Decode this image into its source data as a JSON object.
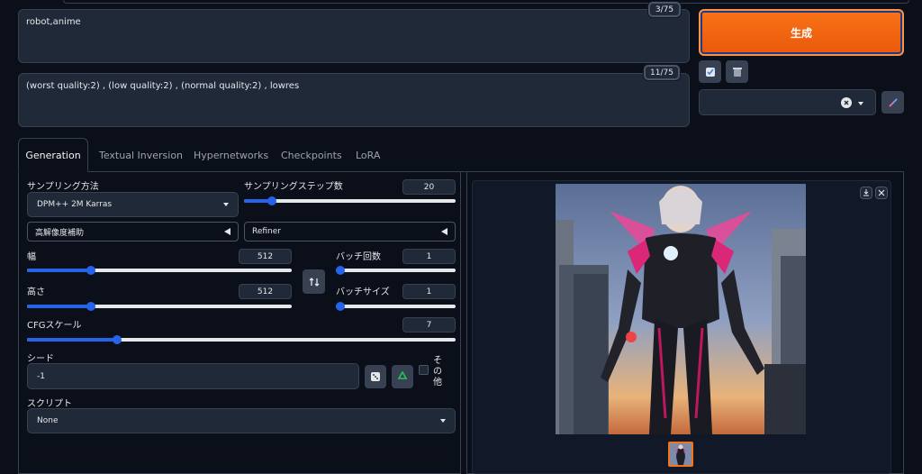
{
  "prompt": {
    "positive_text": "robot,anime",
    "positive_count": "3/75",
    "negative_text": "(worst quality:2) , (low quality:2) , (normal quality:2) , lowres",
    "negative_count": "11/75"
  },
  "toolbar": {
    "generate_label": "生成"
  },
  "tabs": [
    {
      "label": "Generation"
    },
    {
      "label": "Textual Inversion"
    },
    {
      "label": "Hypernetworks"
    },
    {
      "label": "Checkpoints"
    },
    {
      "label": "LoRA"
    }
  ],
  "settings": {
    "sampler": {
      "label": "サンプリング方法",
      "value": "DPM++ 2M Karras"
    },
    "steps": {
      "label": "サンプリングステップ数",
      "value": "20",
      "fraction": 0.13
    },
    "hires_label": "高解像度補助",
    "refiner_label": "Refiner",
    "width": {
      "label": "幅",
      "value": "512",
      "fraction": 0.24
    },
    "height": {
      "label": "高さ",
      "value": "512",
      "fraction": 0.24
    },
    "batch_count": {
      "label": "バッチ回数",
      "value": "1",
      "fraction": 0.0
    },
    "batch_size": {
      "label": "バッチサイズ",
      "value": "1",
      "fraction": 0.0
    },
    "cfg": {
      "label": "CFGスケール",
      "value": "7",
      "fraction": 0.21
    },
    "seed": {
      "label": "シード",
      "value": "-1"
    },
    "extra_label": "その他",
    "script": {
      "label": "スクリプト",
      "value": "None"
    }
  },
  "colors": {
    "background": "#0b0f19",
    "accent": "#2563eb",
    "generate": "#f97316"
  },
  "icons": [
    "pencil-check-icon",
    "trash-icon",
    "clear-x-icon",
    "brush-icon",
    "swap-icon",
    "dice-icon",
    "recycle-icon",
    "download-icon",
    "close-icon"
  ]
}
